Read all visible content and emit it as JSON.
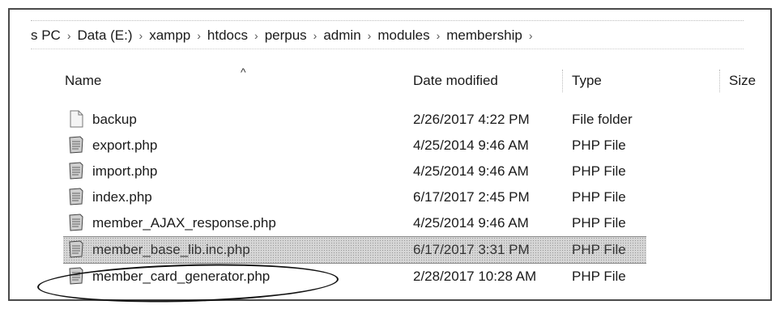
{
  "breadcrumb": [
    "s PC",
    "Data (E:)",
    "xampp",
    "htdocs",
    "perpus",
    "admin",
    "modules",
    "membership"
  ],
  "breadcrumb_separator": "›",
  "columns": {
    "name": "Name",
    "date_modified": "Date modified",
    "type": "Type",
    "size": "Size"
  },
  "sort_indicator": "^",
  "files": [
    {
      "name": "backup",
      "date": "2/26/2017 4:22 PM",
      "type": "File folder",
      "icon": "blank-file-icon"
    },
    {
      "name": "export.php",
      "date": "4/25/2014 9:46 AM",
      "type": "PHP File",
      "icon": "php-file-icon"
    },
    {
      "name": "import.php",
      "date": "4/25/2014 9:46 AM",
      "type": "PHP File",
      "icon": "php-file-icon"
    },
    {
      "name": "index.php",
      "date": "6/17/2017 2:45 PM",
      "type": "PHP File",
      "icon": "php-file-icon"
    },
    {
      "name": "member_AJAX_response.php",
      "date": "4/25/2014 9:46 AM",
      "type": "PHP File",
      "icon": "php-file-icon"
    },
    {
      "name": "member_base_lib.inc.php",
      "date": "6/17/2017 3:31 PM",
      "type": "PHP File",
      "icon": "php-file-icon",
      "selected": true
    },
    {
      "name": "member_card_generator.php",
      "date": "2/28/2017 10:28 AM",
      "type": "PHP File",
      "icon": "php-file-icon",
      "circled": true
    }
  ]
}
